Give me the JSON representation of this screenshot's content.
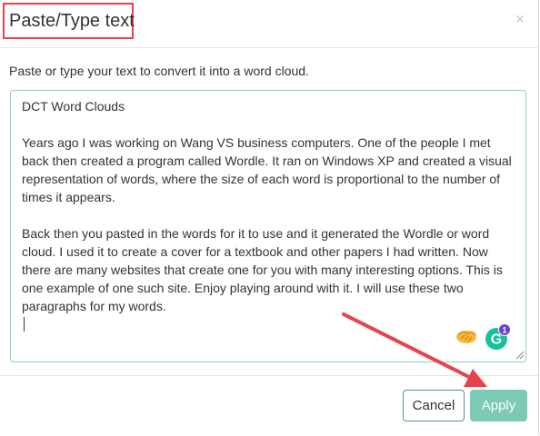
{
  "dialog": {
    "title": "Paste/Type text",
    "close_label": "×",
    "instruction": "Paste or type your text to convert it into a word cloud."
  },
  "textarea": {
    "line1": "DCT Word Clouds",
    "paragraph1": "Years ago I was working on Wang VS business computers. One of the people I met back then created a program called Wordle. It ran on Windows XP and created a visual representation of words, where the size of each word is proportional to the number of times it appears.",
    "paragraph2": "Back then you pasted in the words for it to use and it generated the Wordle or word cloud. I used it to create a cover for a textbook and other papers I had written. Now there are many websites that create one for you with many interesting options. This is one example of one such site. Enjoy playing around with it. I will use these two paragraphs for my words."
  },
  "grammarly": {
    "letter": "G",
    "badge_count": "1"
  },
  "buttons": {
    "cancel": "Cancel",
    "apply": "Apply"
  },
  "colors": {
    "accent": "#7ccab4",
    "annotation_red": "#e8424c",
    "grammarly_green": "#15c39a",
    "badge_purple": "#6d3fd6"
  },
  "icons": [
    "close-icon",
    "hands-emoji-icon",
    "grammarly-icon",
    "resize-handle-icon",
    "annotation-arrow"
  ]
}
